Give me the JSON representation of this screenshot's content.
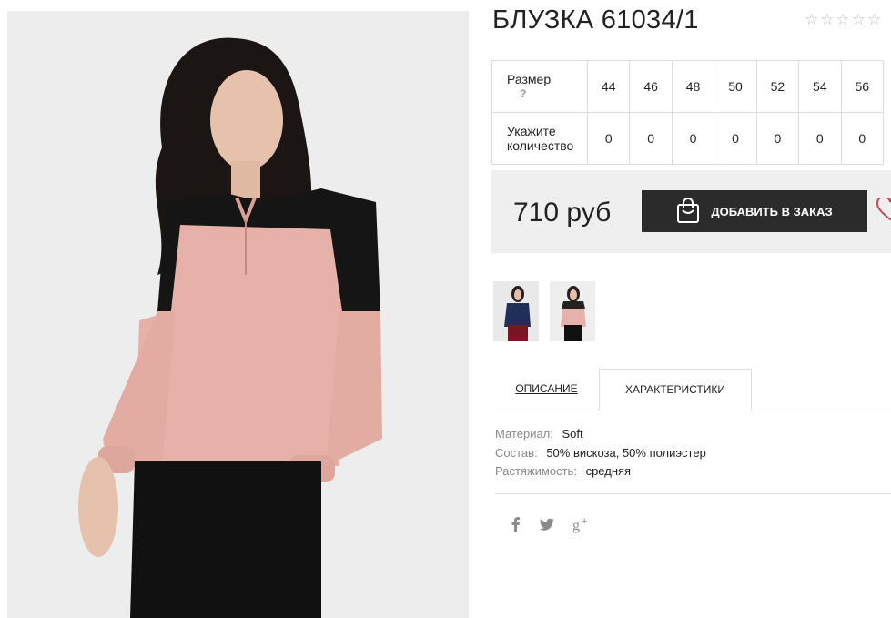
{
  "product": {
    "title": "БЛУЗКА 61034/1",
    "rating_icons": [
      "star-outline",
      "star-outline",
      "star-outline",
      "star-outline",
      "star-outline"
    ]
  },
  "sizes": {
    "label_size": "Размер",
    "help": "?",
    "label_qty_line1": "Укажите",
    "label_qty_line2": "количество",
    "values": [
      "44",
      "46",
      "48",
      "50",
      "52",
      "54",
      "56"
    ],
    "quantities": [
      "0",
      "0",
      "0",
      "0",
      "0",
      "0",
      "0"
    ]
  },
  "buy": {
    "price": "710 руб",
    "add_label": "ДОБАВИТЬ В ЗАКАЗ",
    "icons": [
      "shopping-bag-icon",
      "heart-icon"
    ]
  },
  "tabs": {
    "description": "ОПИСАНИЕ",
    "characteristics": "ХАРАКТЕРИСТИКИ"
  },
  "specs": [
    {
      "key": "Материал:",
      "value": "Soft"
    },
    {
      "key": "Состав:",
      "value": "50% вискоза, 50% полиэстер"
    },
    {
      "key": "Растяжимость:",
      "value": "средняя"
    }
  ],
  "social": [
    "facebook-icon",
    "twitter-icon",
    "google-plus-icon"
  ],
  "colors": {
    "accent_dark": "#2b2b2b",
    "blouse_pink": "#e6b1a8",
    "heart": "#c24a5a"
  }
}
